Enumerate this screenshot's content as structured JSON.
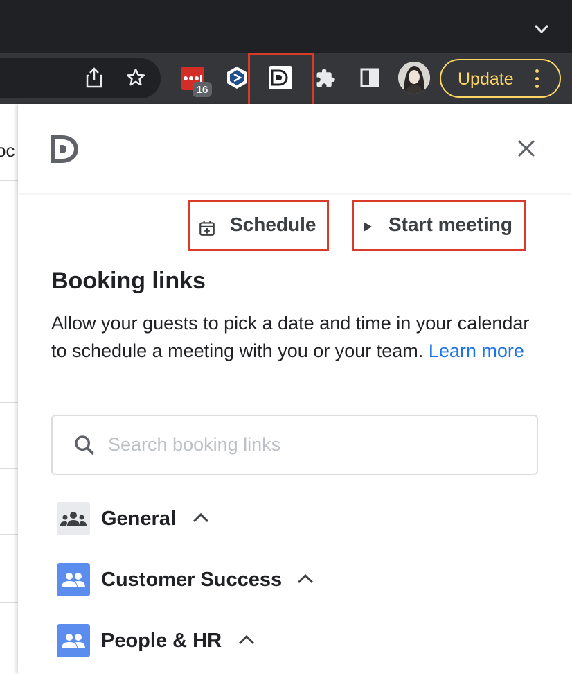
{
  "browser": {
    "extension_badge_count": "16",
    "update_label": "Update",
    "icons": [
      "chevron-down-icon",
      "share-icon",
      "star-icon",
      "lastpass-icon",
      "dotdash-icon",
      "dashlane-icon",
      "puzzle-icon",
      "sidepanel-icon",
      "avatar",
      "menu-dots-icon"
    ],
    "colors": {
      "titlebar": "#202124",
      "toolbar": "#35363a",
      "update_accent": "#fdd663",
      "highlight": "#d93b2b"
    }
  },
  "background": {
    "partial_text": "oc"
  },
  "panel": {
    "actions": {
      "schedule_label": "Schedule",
      "start_meeting_label": "Start meeting"
    },
    "heading": "Booking links",
    "description": "Allow your guests to pick a date and time in your calendar to schedule a meeting with you or your team.",
    "learn_more": "Learn more",
    "search": {
      "placeholder": "Search booking links"
    },
    "groups": [
      {
        "label": "General",
        "icon": "groups-icon"
      },
      {
        "label": "Customer Success",
        "icon": "people-icon"
      },
      {
        "label": "People & HR",
        "icon": "people-icon"
      }
    ],
    "colors": {
      "link": "#1a73e8",
      "group_blue": "#5b8def",
      "group_gray": "#e8eaed"
    }
  }
}
